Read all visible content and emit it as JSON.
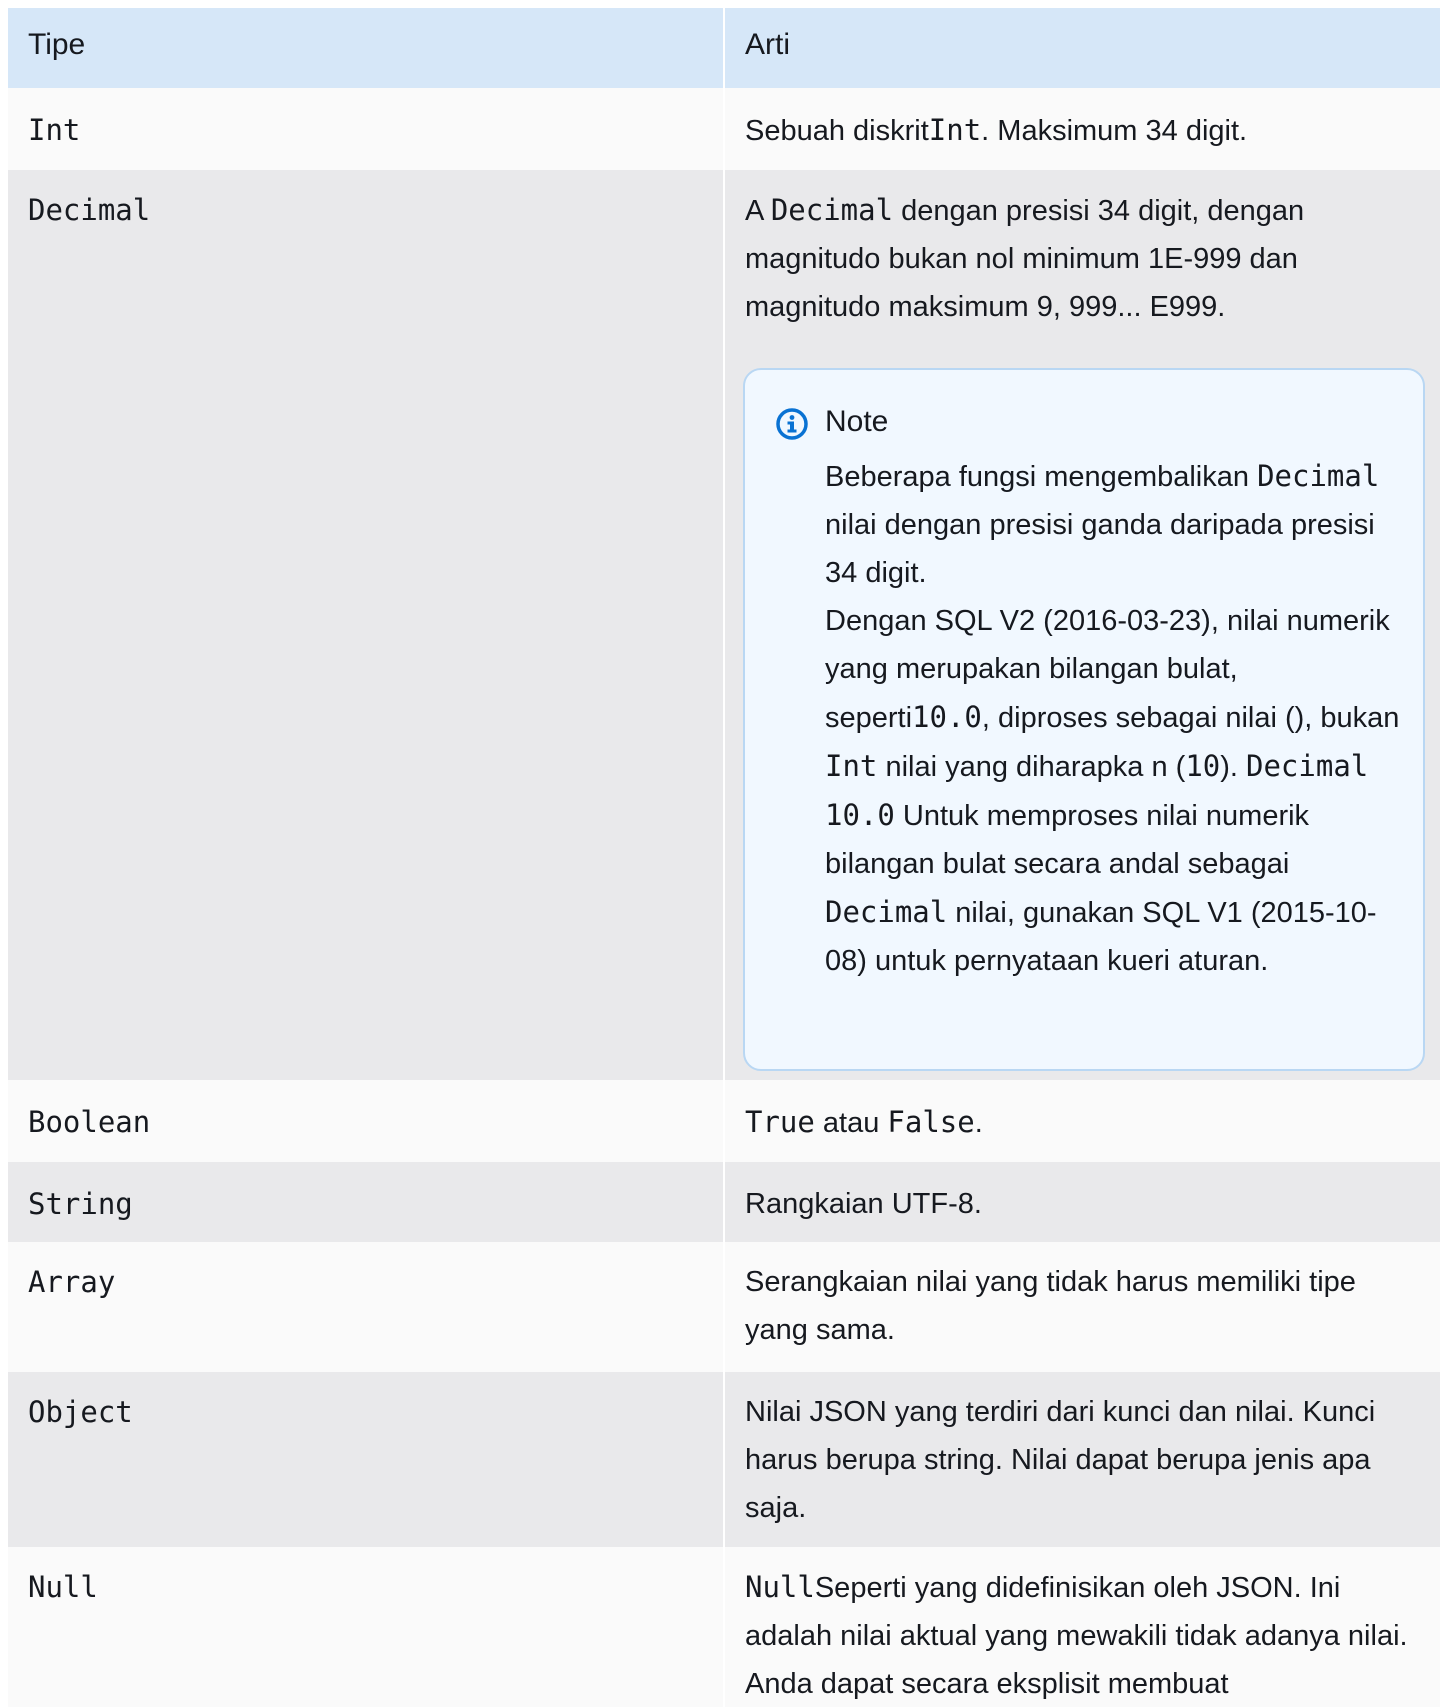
{
  "header": {
    "col1": "Tipe",
    "col2": "Arti"
  },
  "rows": {
    "int": {
      "type": "Int",
      "pre": "Sebuah diskrit",
      "code": "Int",
      "post": ". Maksimum 34 digit."
    },
    "dec": {
      "type": "Decimal",
      "pre": "A ",
      "code": "Decimal",
      "post": " dengan presisi 34 digit, dengan magnitudo bukan nol minimum 1E-999 dan magnitudo maksimum 9, 999... E999."
    },
    "bool": {
      "type": "Boolean",
      "code1": "True",
      "mid": " atau ",
      "code2": "False",
      "post": "."
    },
    "str": {
      "type": "String",
      "text": "Rangkaian UTF-8."
    },
    "arr": {
      "type": "Array",
      "text": "Serangkaian nilai yang tidak harus memiliki tipe yang sama."
    },
    "obj": {
      "type": "Object",
      "text": "Nilai JSON yang terdiri dari kunci dan nilai. Kunci harus berupa string. Nilai dapat berupa jenis apa saja."
    },
    "null": {
      "type": "Null",
      "code": "Null",
      "post": "Seperti yang didefinisikan oleh JSON. Ini adalah nilai aktual yang mewakili tidak adanya nilai. Anda dapat secara eksplisit membuat"
    }
  },
  "note": {
    "title": "Note",
    "p1_pre": "Beberapa fungsi mengembalikan ",
    "p1_code": "Decimal",
    "p1_post": " nilai dengan presisi ganda daripada presisi 34 digit.",
    "p2_a": "Dengan SQL V2 (2016-03-23), nilai numerik yang merupakan bilangan bulat, seperti",
    "p2_code1": "10.0",
    "p2_b": ", diproses sebagai nilai (), bukan ",
    "p2_code2": "Int",
    "p2_c": " nilai yang diharapka n (",
    "p2_code3": "10",
    "p2_d": "). ",
    "p2_code4": "Decimal",
    "p2_e": " ",
    "p2_code5": "10.0",
    "p2_f": " Untuk memproses nilai numerik bilangan bulat secara andal sebagai ",
    "p2_code6": "Decimal",
    "p2_g": " nilai, gunakan SQL V1 (2015-10-08) untuk pernyataan kueri aturan.",
    "icon": "info-icon",
    "accent": "#0972d3"
  }
}
